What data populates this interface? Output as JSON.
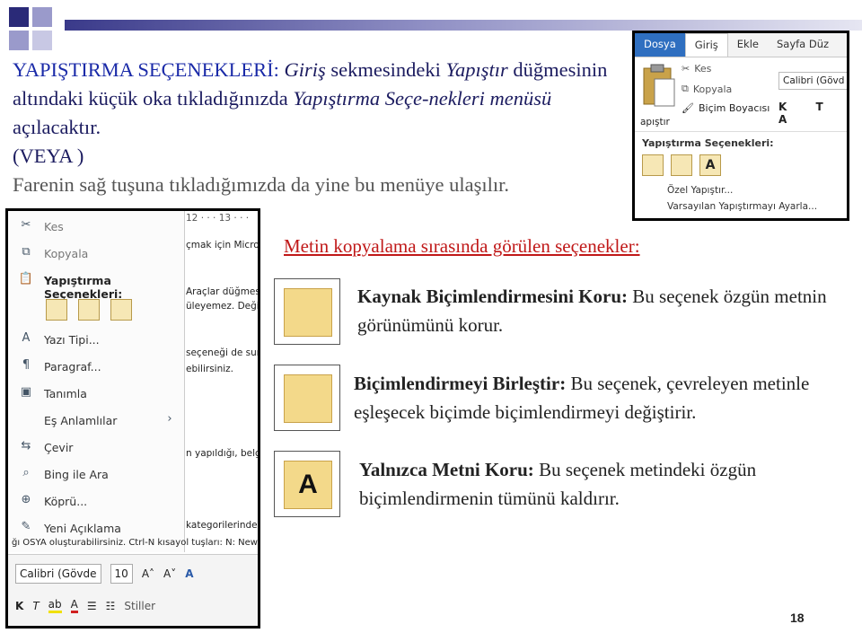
{
  "intro": {
    "title": "YAPIŞTIRMA SEÇENEKLERİ:",
    "p1_a": " ",
    "p1_tab": "Giriş",
    "p1_b": " sekmesindeki ",
    "p1_btn": "Yapıştır",
    "p1_c": " düğmesinin altındaki küçük oka tıkladığınızda ",
    "p1_menu": "Yapıştırma Seçe-nekleri menüsü",
    "p1_d": " açılacaktır.",
    "or": "(VEYA )",
    "p2": "Farenin sağ tuşuna tıkladığımızda da yine bu menüye ulaşılır."
  },
  "ribbon": {
    "tabs": [
      "Dosya",
      "Giriş",
      "Ekle",
      "Sayfa Düz"
    ],
    "cut": "Kes",
    "copy": "Kopyala",
    "format_painter": "Biçim Boyacısı",
    "paste": "apıştır",
    "font": "Calibri (Gövd",
    "fmt": "K T A",
    "paste_options": "Yapıştırma Seçenekleri:",
    "special": "Özel Yapıştır...",
    "default": "Varsayılan Yapıştırmayı Ayarla..."
  },
  "context": {
    "ruler": "12 · · · 13 · · ·",
    "items": [
      "Kes",
      "Kopyala",
      "Yapıştırma Seçenekleri:",
      "Yazı Tipi...",
      "Paragraf...",
      "Tanımla",
      "Eş Anlamlılar",
      "Çevir",
      "Bing ile Ara",
      "Köprü...",
      "Yeni Açıklama"
    ],
    "doc_lines": [
      "çmak için Micros",
      "Araçlar düğmesin",
      "üleyemez. Değiş",
      "seçeneği de sun",
      "ebilirsiniz.",
      "n yapıldığı, belge",
      "kategorilerinden"
    ],
    "bottom_line": "ğı OSYA oluşturabilirsiniz. Ctrl-N kısayol tuşları: N: New",
    "mini_font": "Calibri (Gövde",
    "mini_size": "10",
    "mini_styles": "Stiller"
  },
  "heading": "Metin kopyalama sırasında görülen seçenekler:",
  "options": [
    {
      "title": "Kaynak Biçimlendirmesini Koru:",
      "text": " Bu seçenek özgün metnin görünümünü korur."
    },
    {
      "title": "Biçimlendirmeyi Birleştir:",
      "text": " Bu seçenek, çevreleyen metinle eşleşecek biçimde biçimlendirmeyi değiştirir."
    },
    {
      "title": "Yalnızca Metni Koru:",
      "text": " Bu seçenek metindeki özgün biçimlendirmenin tümünü kaldırır."
    }
  ],
  "page_number": "18",
  "colors": {
    "title_blue": "#1a2aa8",
    "heading_red": "#c01818",
    "deco_blue": "#3a3a8a"
  }
}
